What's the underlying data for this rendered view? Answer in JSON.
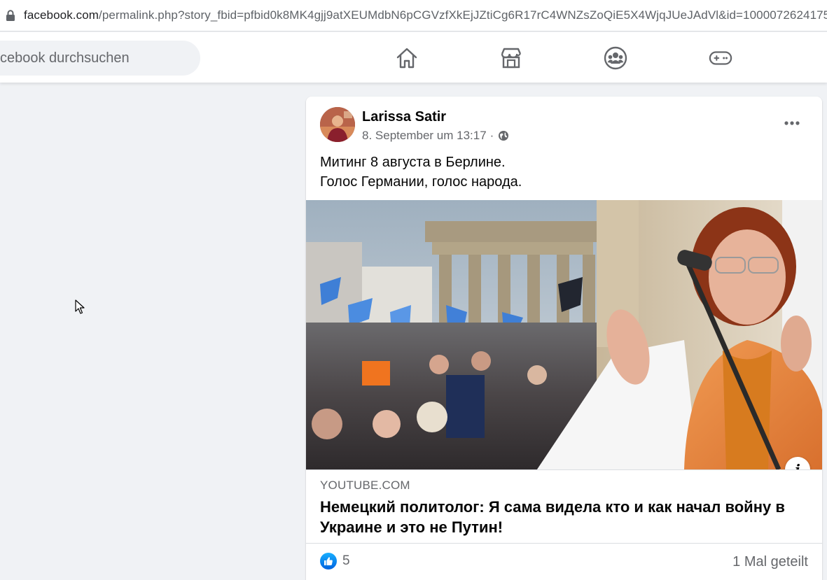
{
  "browser": {
    "url_domain": "facebook.com",
    "url_path": "/permalink.php?story_fbid=pfbid0k8MK4gjj9atXEUMdbN6pCGVzfXkEjJZtiCg6R17rC4WNZsZoQiE5X4WjqJUeJAdVl&id=1000072624175"
  },
  "topbar": {
    "search_placeholder": "cebook durchsuchen",
    "nav": [
      "home-icon",
      "marketplace-icon",
      "groups-icon",
      "gaming-icon"
    ]
  },
  "post": {
    "author": "Larissa Satir",
    "timestamp": "8. September um 13:17",
    "dot": "·",
    "privacy_icon": "globe-icon",
    "more_icon": "more-horizontal-icon",
    "text_lines": [
      "Митинг 8 августа в Берлине.",
      "Голос Германии, голос народа."
    ],
    "link": {
      "domain": "YOUTUBE.COM",
      "title": "Немецкий политолог: Я сама видела кто и как начал войну в Украине и это не Путин!",
      "info_label": "i"
    },
    "reactions": {
      "like_count": "5",
      "shares": "1 Mal geteilt"
    }
  },
  "colors": {
    "fb_blue": "#1877f2",
    "secondary_text": "#65676b",
    "page_bg": "#f0f2f5"
  }
}
